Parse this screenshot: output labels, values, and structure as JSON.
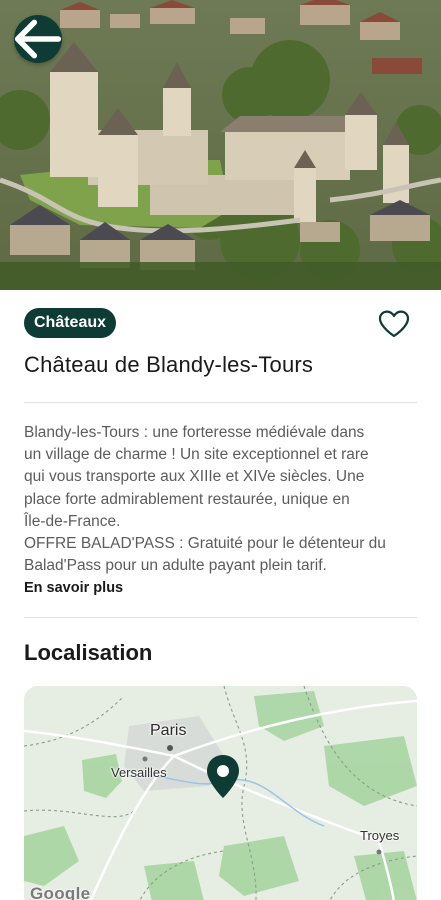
{
  "header": {
    "back_icon": "arrow-left-icon",
    "image_subject": "aerial view of a medieval castle"
  },
  "details": {
    "category": "Châteaux",
    "favorite_icon": "heart-outline-icon",
    "title": "Château de Blandy-les-Tours",
    "description_lines": [
      "Blandy-les-Tours : une forteresse médiévale dans",
      "un village de charme ! Un site exceptionnel et rare",
      "qui vous transporte aux XIIIe et XIVe siècles. Une",
      "place forte admirablement restaurée, unique en",
      "Île-de-France.",
      "OFFRE BALAD'PASS : Gratuité pour le détenteur du",
      "Balad'Pass pour un adulte payant plein tarif."
    ],
    "read_more": "En savoir plus"
  },
  "location": {
    "section_title": "Localisation",
    "map": {
      "labels": {
        "paris": "Paris",
        "versailles": "Versailles",
        "troyes": "Troyes"
      },
      "attribution": "Google",
      "pin_icon": "map-pin-icon"
    }
  },
  "colors": {
    "primary": "#0e3b34",
    "text": "#1a1a1a",
    "muted_text": "#5c5c5c",
    "divider": "#e3e3e3",
    "map_land": "#e4ece1",
    "map_forest": "#a8d5a2"
  }
}
